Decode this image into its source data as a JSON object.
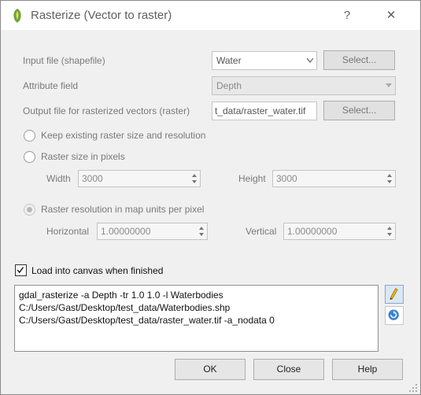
{
  "window": {
    "title": "Rasterize (Vector to raster)",
    "help_glyph": "?",
    "close_glyph": "✕"
  },
  "input_file": {
    "label": "Input file (shapefile)",
    "value": "Water",
    "select_label": "Select..."
  },
  "attribute_field": {
    "label": "Attribute field",
    "value": "Depth"
  },
  "output_file": {
    "label": "Output file for rasterized vectors (raster)",
    "value": "t_data/raster_water.tif",
    "select_label": "Select..."
  },
  "options": {
    "keep_size_label": "Keep existing raster size and resolution",
    "size_pixels_label": "Raster size in pixels",
    "width_label": "Width",
    "width_value": "3000",
    "height_label": "Height",
    "height_value": "3000",
    "resolution_label": "Raster resolution in map units per pixel",
    "horizontal_label": "Horizontal",
    "horizontal_value": "1.00000000",
    "vertical_label": "Vertical",
    "vertical_value": "1.00000000"
  },
  "load_canvas": {
    "label": "Load into canvas when finished",
    "checked": true
  },
  "command": {
    "line1": "gdal_rasterize -a Depth -tr 1.0 1.0 -l Waterbodies",
    "line2": "C:/Users/Gast/Desktop/test_data/Waterbodies.shp",
    "line3": "C:/Users/Gast/Desktop/test_data/raster_water.tif -a_nodata 0"
  },
  "buttons": {
    "ok": "OK",
    "close": "Close",
    "help": "Help"
  },
  "icons": {
    "app": "qgis-icon",
    "edit": "pencil-icon",
    "reset": "refresh-icon"
  }
}
